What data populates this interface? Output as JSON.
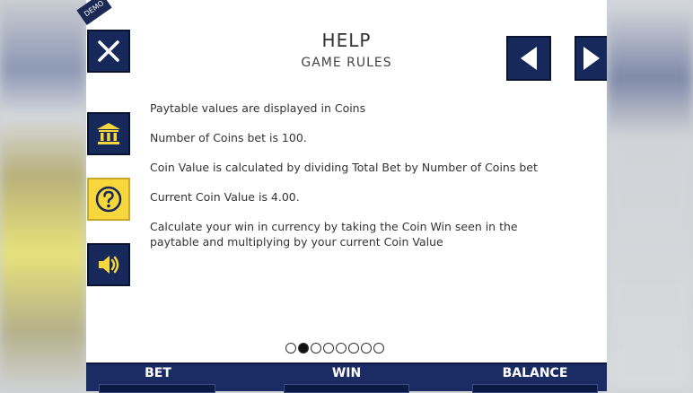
{
  "header": {
    "title": "HELP",
    "subtitle": "GAME RULES"
  },
  "ribbon": "DEMO",
  "rules": [
    "Paytable values are displayed in Coins",
    "Number of Coins bet is 100.",
    "Coin Value is calculated by dividing Total Bet by Number of Coins bet",
    "Current Coin Value is 4.00.",
    "Calculate your win in currency by taking the Coin Win seen in the paytable and multiplying by your current Coin Value"
  ],
  "pagination": {
    "total": 8,
    "current": 2
  },
  "footer": {
    "bet": "BET",
    "win": "WIN",
    "balance": "BALANCE"
  },
  "colors": {
    "navy": "#17295a",
    "accent": "#f7d73b"
  },
  "icons": [
    "close-icon",
    "paytable-icon",
    "help-icon",
    "sound-icon",
    "arrow-left-icon",
    "arrow-right-icon"
  ]
}
